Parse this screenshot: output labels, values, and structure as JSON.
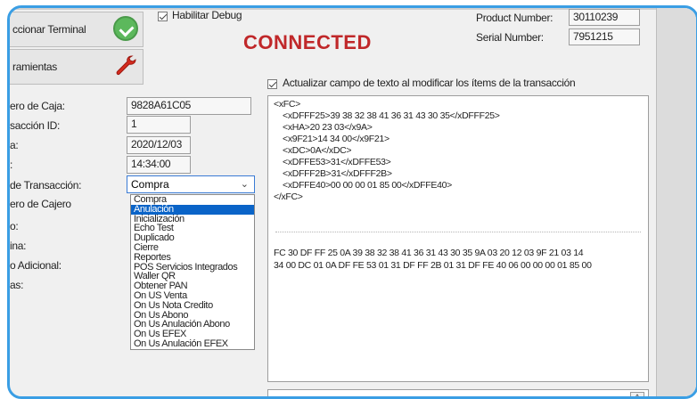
{
  "header": {
    "seleccionar_terminal_label": "ccionar Terminal",
    "herramientas_label": "ramientas",
    "habilitar_debug_label": "Habilitar Debug",
    "status_text": "CONNECTED",
    "product_number_label": "Product Number:",
    "product_number_value": "30110239",
    "serial_number_label": "Serial Number:",
    "serial_number_value": "7951215"
  },
  "form": {
    "rows": [
      {
        "label": "ero de Caja:",
        "value": "9828A61C05"
      },
      {
        "label": "sacción ID:",
        "value": "1"
      },
      {
        "label": "a:",
        "value": "2020/12/03"
      },
      {
        "label": ":",
        "value": "14:34:00"
      },
      {
        "label": "de Transacción:",
        "value": "Compra"
      },
      {
        "label": "ero de Cajero",
        "value": ""
      },
      {
        "label": "o:",
        "value": ""
      },
      {
        "label": "ina:",
        "value": ""
      },
      {
        "label": "o Adicional:",
        "value": ""
      },
      {
        "label": "as:",
        "value": ""
      }
    ]
  },
  "transaction_dropdown": {
    "selected_display": "Compra",
    "options": [
      "Compra",
      "Anulación",
      "Inicialización",
      "Echo Test",
      "Duplicado",
      "Cierre",
      "Reportes",
      "POS Servicios Integrados",
      "Waller QR",
      "Obtener PAN",
      "On US Venta",
      "On Us Nota Credito",
      "On Us Abono",
      "On Us Anulación Abono",
      "On Us EFEX",
      "On Us Anulación EFEX"
    ],
    "highlighted_index": 1
  },
  "update_checkbox_label": "Actualizar campo de texto al modificar los ítems de la transacción",
  "xml_lines": [
    "<xFC>",
    "  <xDFFF25>39 38 32 38 41 36 31 43 30 35</xDFFF25>",
    "  <xHA>20 23 03</x9A>",
    "  <x9F21>14 34 00</x9F21>",
    "  <xDC>0A</xDC>",
    "  <xDFFE53>31</xDFFE53>",
    "  <xDFFF2B>31</xDFFF2B>",
    "  <xDFFE40>00 00 00 01 85 00</xDFFE40>",
    "</xFC>"
  ],
  "hex_lines": [
    "FC 30 DF FF 25 0A 39 38 32 38 41 36 31 43 30 35 9A 03 20 12 03 9F 21 03 14",
    "34 00 DC 01 0A DF FE 53 01 31 DF FF 2B 01 31 DF FE 40 06 00 00 00 01 85 00"
  ],
  "scroll_up_glyph": "^",
  "dropdown_chevron": "⌄",
  "icons": [
    "check-circle-icon",
    "wrench-icon",
    "chevron-down-icon",
    "scroll-up-icon"
  ],
  "colors": {
    "accent_border": "#3a9ee4",
    "status_red": "#c0282a",
    "selection_blue": "#0a64c8",
    "success_green": "#5cb85c"
  }
}
